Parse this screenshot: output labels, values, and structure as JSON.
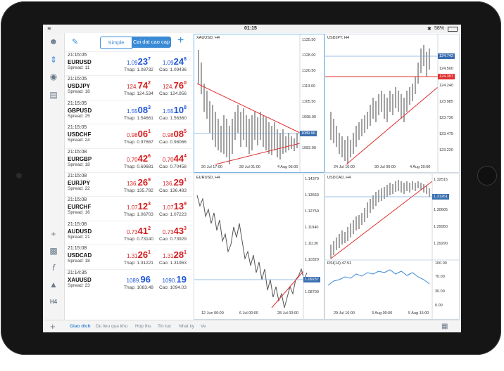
{
  "status": {
    "carrier": "iPad",
    "time": "01:15",
    "battery": "58%"
  },
  "toolbar": {
    "simple_label": "Simple",
    "advanced_label": "Cai dat cao cap",
    "add_label": "+"
  },
  "quotes": [
    {
      "time": "21:15:05",
      "symbol": "EURUSD",
      "spread": "Spread: 11",
      "bid_main": "1.09",
      "bid_big": "23",
      "bid_sup": "7",
      "ask_main": "1.09",
      "ask_big": "24",
      "ask_sup": "8",
      "low": "Thap: 1.08732",
      "high": "Cao: 1.09436",
      "bid_color": "blue",
      "ask_color": "blue"
    },
    {
      "time": "21:15:05",
      "symbol": "USDJPY",
      "spread": "Spread: 18",
      "bid_main": "124.",
      "bid_big": "74",
      "bid_sup": "2",
      "ask_main": "124.",
      "ask_big": "76",
      "ask_sup": "0",
      "low": "Thap: 124.534",
      "high": "Cao: 124.956",
      "bid_color": "red",
      "ask_color": "red"
    },
    {
      "time": "21:15:05",
      "symbol": "GBPUSD",
      "spread": "Spread: 25",
      "bid_main": "1.55",
      "bid_big": "08",
      "bid_sup": "3",
      "ask_main": "1.55",
      "ask_big": "10",
      "ask_sup": "8",
      "low": "Thap: 1.54661",
      "high": "Cao: 1.56360",
      "bid_color": "blue",
      "ask_color": "blue"
    },
    {
      "time": "21:15:05",
      "symbol": "USDCHF",
      "spread": "Spread: 24",
      "bid_main": "0.98",
      "bid_big": "06",
      "bid_sup": "1",
      "ask_main": "0.98",
      "ask_big": "08",
      "ask_sup": "5",
      "low": "Thap: 0.97667",
      "high": "Cao: 0.98066",
      "bid_color": "red",
      "ask_color": "red"
    },
    {
      "time": "21:15:08",
      "symbol": "EURGBP",
      "spread": "Spread: 18",
      "bid_main": "0.70",
      "bid_big": "42",
      "bid_sup": "6",
      "ask_main": "0.70",
      "ask_big": "44",
      "ask_sup": "4",
      "low": "Thap: 0.69681",
      "high": "Cao: 0.70458",
      "bid_color": "red",
      "ask_color": "red"
    },
    {
      "time": "21:15:08",
      "symbol": "EURJPY",
      "spread": "Spread: 22",
      "bid_main": "136.",
      "bid_big": "26",
      "bid_sup": "9",
      "ask_main": "136.",
      "ask_big": "29",
      "ask_sup": "1",
      "low": "Thap: 135.792",
      "high": "Cao: 136.483",
      "bid_color": "red",
      "ask_color": "red"
    },
    {
      "time": "21:15:08",
      "symbol": "EURCHF",
      "spread": "Spread: 16",
      "bid_main": "1.07",
      "bid_big": "12",
      "bid_sup": "3",
      "ask_main": "1.07",
      "ask_big": "13",
      "ask_sup": "9",
      "low": "Thap: 1.06703",
      "high": "Cao: 1.07223",
      "bid_color": "red",
      "ask_color": "red"
    },
    {
      "time": "21:15:08",
      "symbol": "AUDUSD",
      "spread": "Spread: 21",
      "bid_main": "0.73",
      "bid_big": "41",
      "bid_sup": "2",
      "ask_main": "0.73",
      "ask_big": "43",
      "ask_sup": "3",
      "low": "Thap: 0.73140",
      "high": "Cao: 0.73929",
      "bid_color": "red",
      "ask_color": "red"
    },
    {
      "time": "21:15:08",
      "symbol": "USDCAD",
      "spread": "Spread: 18",
      "bid_main": "1.31",
      "bid_big": "26",
      "bid_sup": "1",
      "ask_main": "1.31",
      "ask_big": "28",
      "ask_sup": "1",
      "low": "Thap: 1.31221",
      "high": "Cao: 1.31963",
      "bid_color": "red",
      "ask_color": "red"
    },
    {
      "time": "21:14:35",
      "symbol": "XAUUSD",
      "spread": "Spread: 23",
      "bid_main": "1089.",
      "bid_big": "96",
      "bid_sup": "",
      "ask_main": "1090.",
      "ask_big": "19",
      "ask_sup": "",
      "low": "Thap: 1083.49",
      "high": "Cao: 1094.03",
      "bid_color": "blue",
      "ask_color": "blue"
    }
  ],
  "charts": {
    "xauusd": {
      "title": "XAUUSD, H4",
      "prices": [
        "1135.50",
        "1128.00",
        "1120.50",
        "1113.00",
        "1105.50",
        "1098.00",
        "1090.50",
        "1083.00"
      ],
      "tag": "1089.96",
      "dates": [
        "20 Jul 17:00",
        "28 Jul 01:00",
        "4 Aug 05:00"
      ]
    },
    "usdjpy": {
      "title": "USDJPY, H4",
      "prices": [
        "124.742",
        "124.500",
        "124.240",
        "123.985",
        "123.730",
        "123.475",
        "123.220"
      ],
      "tag1": "124.742",
      "tag2": "124.397",
      "dates": [
        "24 Jul 10:00",
        "30 Jul 00:00",
        "4 Aug 20:00"
      ]
    },
    "eurusd": {
      "title": "EURUSD, H4",
      "prices": [
        "1.14370",
        "1.13560",
        "1.12750",
        "1.11940",
        "1.11130",
        "1.10320",
        "1.09237",
        "1.08700"
      ],
      "tag": "1.09237",
      "dates": [
        "12 Jun 00:00",
        "6 Jul 00:00",
        "28 Jul 00:00"
      ]
    },
    "usdcad": {
      "title": "USDCAD, H4",
      "prices": [
        "1.32515",
        "1.31261",
        "1.30605",
        "1.29950",
        "1.29290"
      ],
      "tag": "1.31261",
      "rsi_title": "RSI(14) 47.51",
      "rsi_levels": [
        "100.00",
        "70.00",
        "30.00",
        "0.00"
      ],
      "dates": [
        "29 Jul 16:00",
        "3 Aug 00:00",
        "5 Aug 15:00"
      ]
    }
  },
  "bottom_tabs": [
    "Giao dich",
    "Du lieu qua khu",
    "Hop thu",
    "Tin tuc",
    "Nhat ky",
    "Ve"
  ],
  "side_tools": {
    "timeframe": "H4"
  }
}
